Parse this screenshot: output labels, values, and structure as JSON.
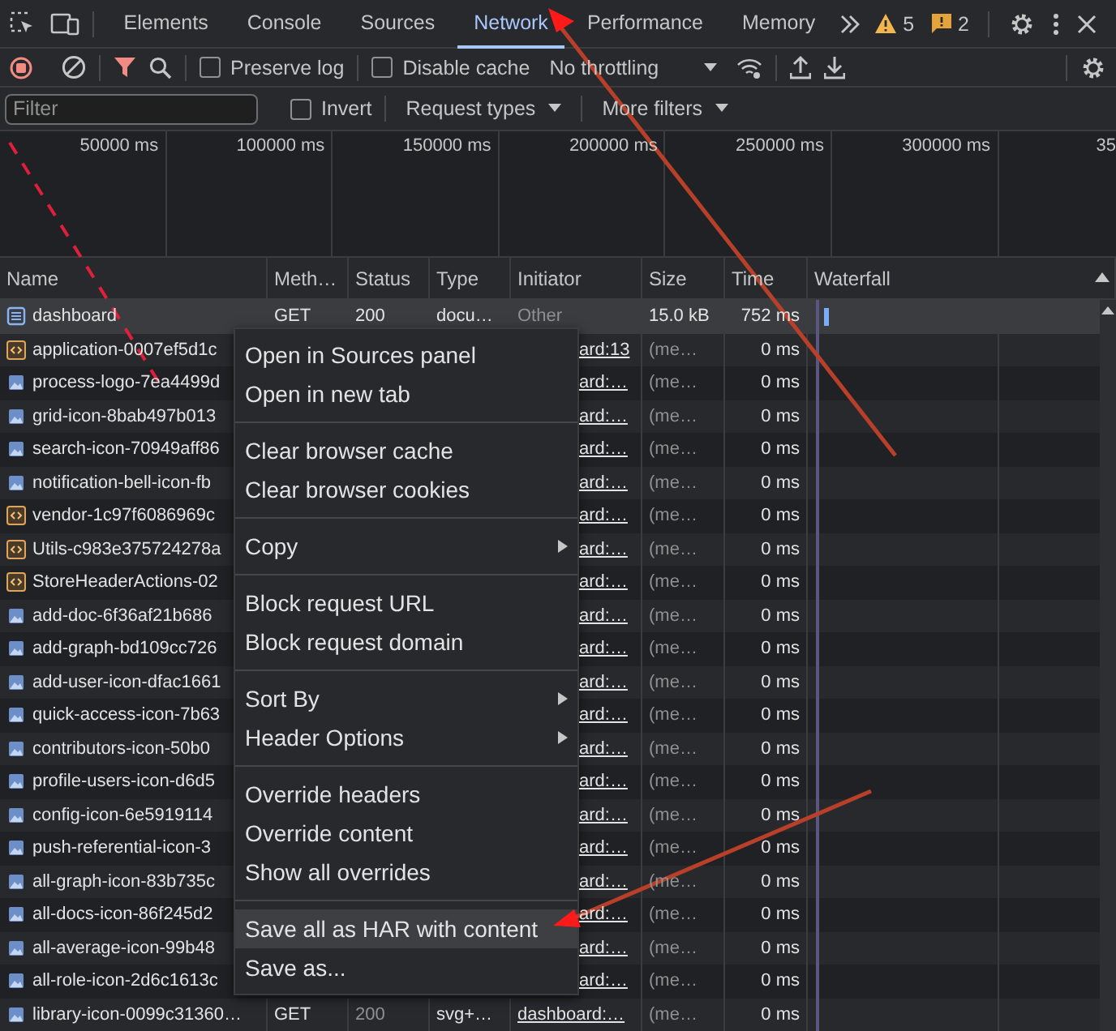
{
  "top_bar": {
    "tabs": [
      {
        "label": "Elements",
        "selected": false
      },
      {
        "label": "Console",
        "selected": false
      },
      {
        "label": "Sources",
        "selected": false
      },
      {
        "label": "Network",
        "selected": true
      },
      {
        "label": "Performance",
        "selected": false
      },
      {
        "label": "Memory",
        "selected": false
      }
    ],
    "warnings": "5",
    "messages": "2"
  },
  "toolbar": {
    "preserve_log": {
      "label": "Preserve log",
      "checked": false
    },
    "disable_cache": {
      "label": "Disable cache",
      "checked": false
    },
    "throttling": "No throttling"
  },
  "filter_bar": {
    "placeholder": "Filter",
    "invert": {
      "label": "Invert",
      "checked": false
    },
    "request_types": "Request types",
    "more_filters": "More filters"
  },
  "overview": {
    "ticks": [
      "50000 ms",
      "100000 ms",
      "150000 ms",
      "200000 ms",
      "250000 ms",
      "300000 ms",
      "35"
    ]
  },
  "table": {
    "columns": [
      "Name",
      "Meth…",
      "Status",
      "Type",
      "Initiator",
      "Size",
      "Time",
      "Waterfall"
    ],
    "rows": [
      {
        "kind": "document",
        "name": "dashboard",
        "method": "GET",
        "status": "200",
        "type": "docu…",
        "initiator": "Other",
        "initiator_link": false,
        "size": "15.0 kB",
        "time": "752 ms",
        "selected": true
      },
      {
        "kind": "script",
        "name": "application-0007ef5d1c",
        "initiator": "ard:13",
        "initiator_link": true,
        "size": "(me…",
        "time": "0 ms",
        "selected": false
      },
      {
        "kind": "image",
        "name": "process-logo-7ea4499d",
        "initiator": "ard:…",
        "initiator_link": true,
        "size": "(me…",
        "time": "0 ms",
        "selected": false
      },
      {
        "kind": "image",
        "name": "grid-icon-8bab497b013",
        "initiator": "ard:…",
        "initiator_link": true,
        "size": "(me…",
        "time": "0 ms",
        "selected": false
      },
      {
        "kind": "image",
        "name": "search-icon-70949aff86",
        "initiator": "ard:…",
        "initiator_link": true,
        "size": "(me…",
        "time": "0 ms",
        "selected": false
      },
      {
        "kind": "image",
        "name": "notification-bell-icon-fb",
        "initiator": "ard:…",
        "initiator_link": true,
        "size": "(me…",
        "time": "0 ms",
        "selected": false
      },
      {
        "kind": "script",
        "name": "vendor-1c97f6086969c",
        "initiator": "ard:…",
        "initiator_link": true,
        "size": "(me…",
        "time": "0 ms",
        "selected": false
      },
      {
        "kind": "script",
        "name": "Utils-c983e375724278a",
        "initiator": "ard:…",
        "initiator_link": true,
        "size": "(me…",
        "time": "0 ms",
        "selected": false
      },
      {
        "kind": "script",
        "name": "StoreHeaderActions-02",
        "initiator": "ard:…",
        "initiator_link": true,
        "size": "(me…",
        "time": "0 ms",
        "selected": false
      },
      {
        "kind": "image",
        "name": "add-doc-6f36af21b686",
        "initiator": "ard:…",
        "initiator_link": true,
        "size": "(me…",
        "time": "0 ms",
        "selected": false
      },
      {
        "kind": "image",
        "name": "add-graph-bd109cc726",
        "initiator": "ard:…",
        "initiator_link": true,
        "size": "(me…",
        "time": "0 ms",
        "selected": false
      },
      {
        "kind": "image",
        "name": "add-user-icon-dfac1661",
        "initiator": "ard:…",
        "initiator_link": true,
        "size": "(me…",
        "time": "0 ms",
        "selected": false
      },
      {
        "kind": "image",
        "name": "quick-access-icon-7b63",
        "initiator": "ard:…",
        "initiator_link": true,
        "size": "(me…",
        "time": "0 ms",
        "selected": false
      },
      {
        "kind": "image",
        "name": "contributors-icon-50b0",
        "initiator": "ard:…",
        "initiator_link": true,
        "size": "(me…",
        "time": "0 ms",
        "selected": false
      },
      {
        "kind": "image",
        "name": "profile-users-icon-d6d5",
        "initiator": "ard:…",
        "initiator_link": true,
        "size": "(me…",
        "time": "0 ms",
        "selected": false
      },
      {
        "kind": "image",
        "name": "config-icon-6e5919114",
        "initiator": "ard:…",
        "initiator_link": true,
        "size": "(me…",
        "time": "0 ms",
        "selected": false
      },
      {
        "kind": "image",
        "name": "push-referential-icon-3",
        "initiator": "ard:…",
        "initiator_link": true,
        "size": "(me…",
        "time": "0 ms",
        "selected": false
      },
      {
        "kind": "image",
        "name": "all-graph-icon-83b735c",
        "initiator": "ard:…",
        "initiator_link": true,
        "size": "(me…",
        "time": "0 ms",
        "selected": false
      },
      {
        "kind": "image",
        "name": "all-docs-icon-86f245d2",
        "initiator": "ard:…",
        "initiator_link": true,
        "size": "(me…",
        "time": "0 ms",
        "selected": false
      },
      {
        "kind": "image",
        "name": "all-average-icon-99b48",
        "initiator": "ard:…",
        "initiator_link": true,
        "size": "(me…",
        "time": "0 ms",
        "selected": false
      },
      {
        "kind": "image",
        "name": "all-role-icon-2d6c1613c",
        "initiator": "ard:…",
        "initiator_link": true,
        "size": "(me…",
        "time": "0 ms",
        "selected": false
      },
      {
        "kind": "image",
        "name": "library-icon-0099c31360…",
        "method": "GET",
        "status": "200",
        "type": "svg+…",
        "initiator": "dashboard:…",
        "initiator_link": true,
        "size": "(me…",
        "time": "0 ms",
        "selected": false
      }
    ]
  },
  "context_menu": {
    "groups": [
      [
        {
          "label": "Open in Sources panel",
          "submenu": false,
          "selected": false
        },
        {
          "label": "Open in new tab",
          "submenu": false,
          "selected": false
        }
      ],
      [
        {
          "label": "Clear browser cache",
          "submenu": false,
          "selected": false
        },
        {
          "label": "Clear browser cookies",
          "submenu": false,
          "selected": false
        }
      ],
      [
        {
          "label": "Copy",
          "submenu": true,
          "selected": false
        }
      ],
      [
        {
          "label": "Block request URL",
          "submenu": false,
          "selected": false
        },
        {
          "label": "Block request domain",
          "submenu": false,
          "selected": false
        }
      ],
      [
        {
          "label": "Sort By",
          "submenu": true,
          "selected": false
        },
        {
          "label": "Header Options",
          "submenu": true,
          "selected": false
        }
      ],
      [
        {
          "label": "Override headers",
          "submenu": false,
          "selected": false
        },
        {
          "label": "Override content",
          "submenu": false,
          "selected": false
        },
        {
          "label": "Show all overrides",
          "submenu": false,
          "selected": false
        }
      ],
      [
        {
          "label": "Save all as HAR with content",
          "submenu": false,
          "selected": true
        },
        {
          "label": "Save as...",
          "submenu": false,
          "selected": false
        }
      ]
    ]
  }
}
